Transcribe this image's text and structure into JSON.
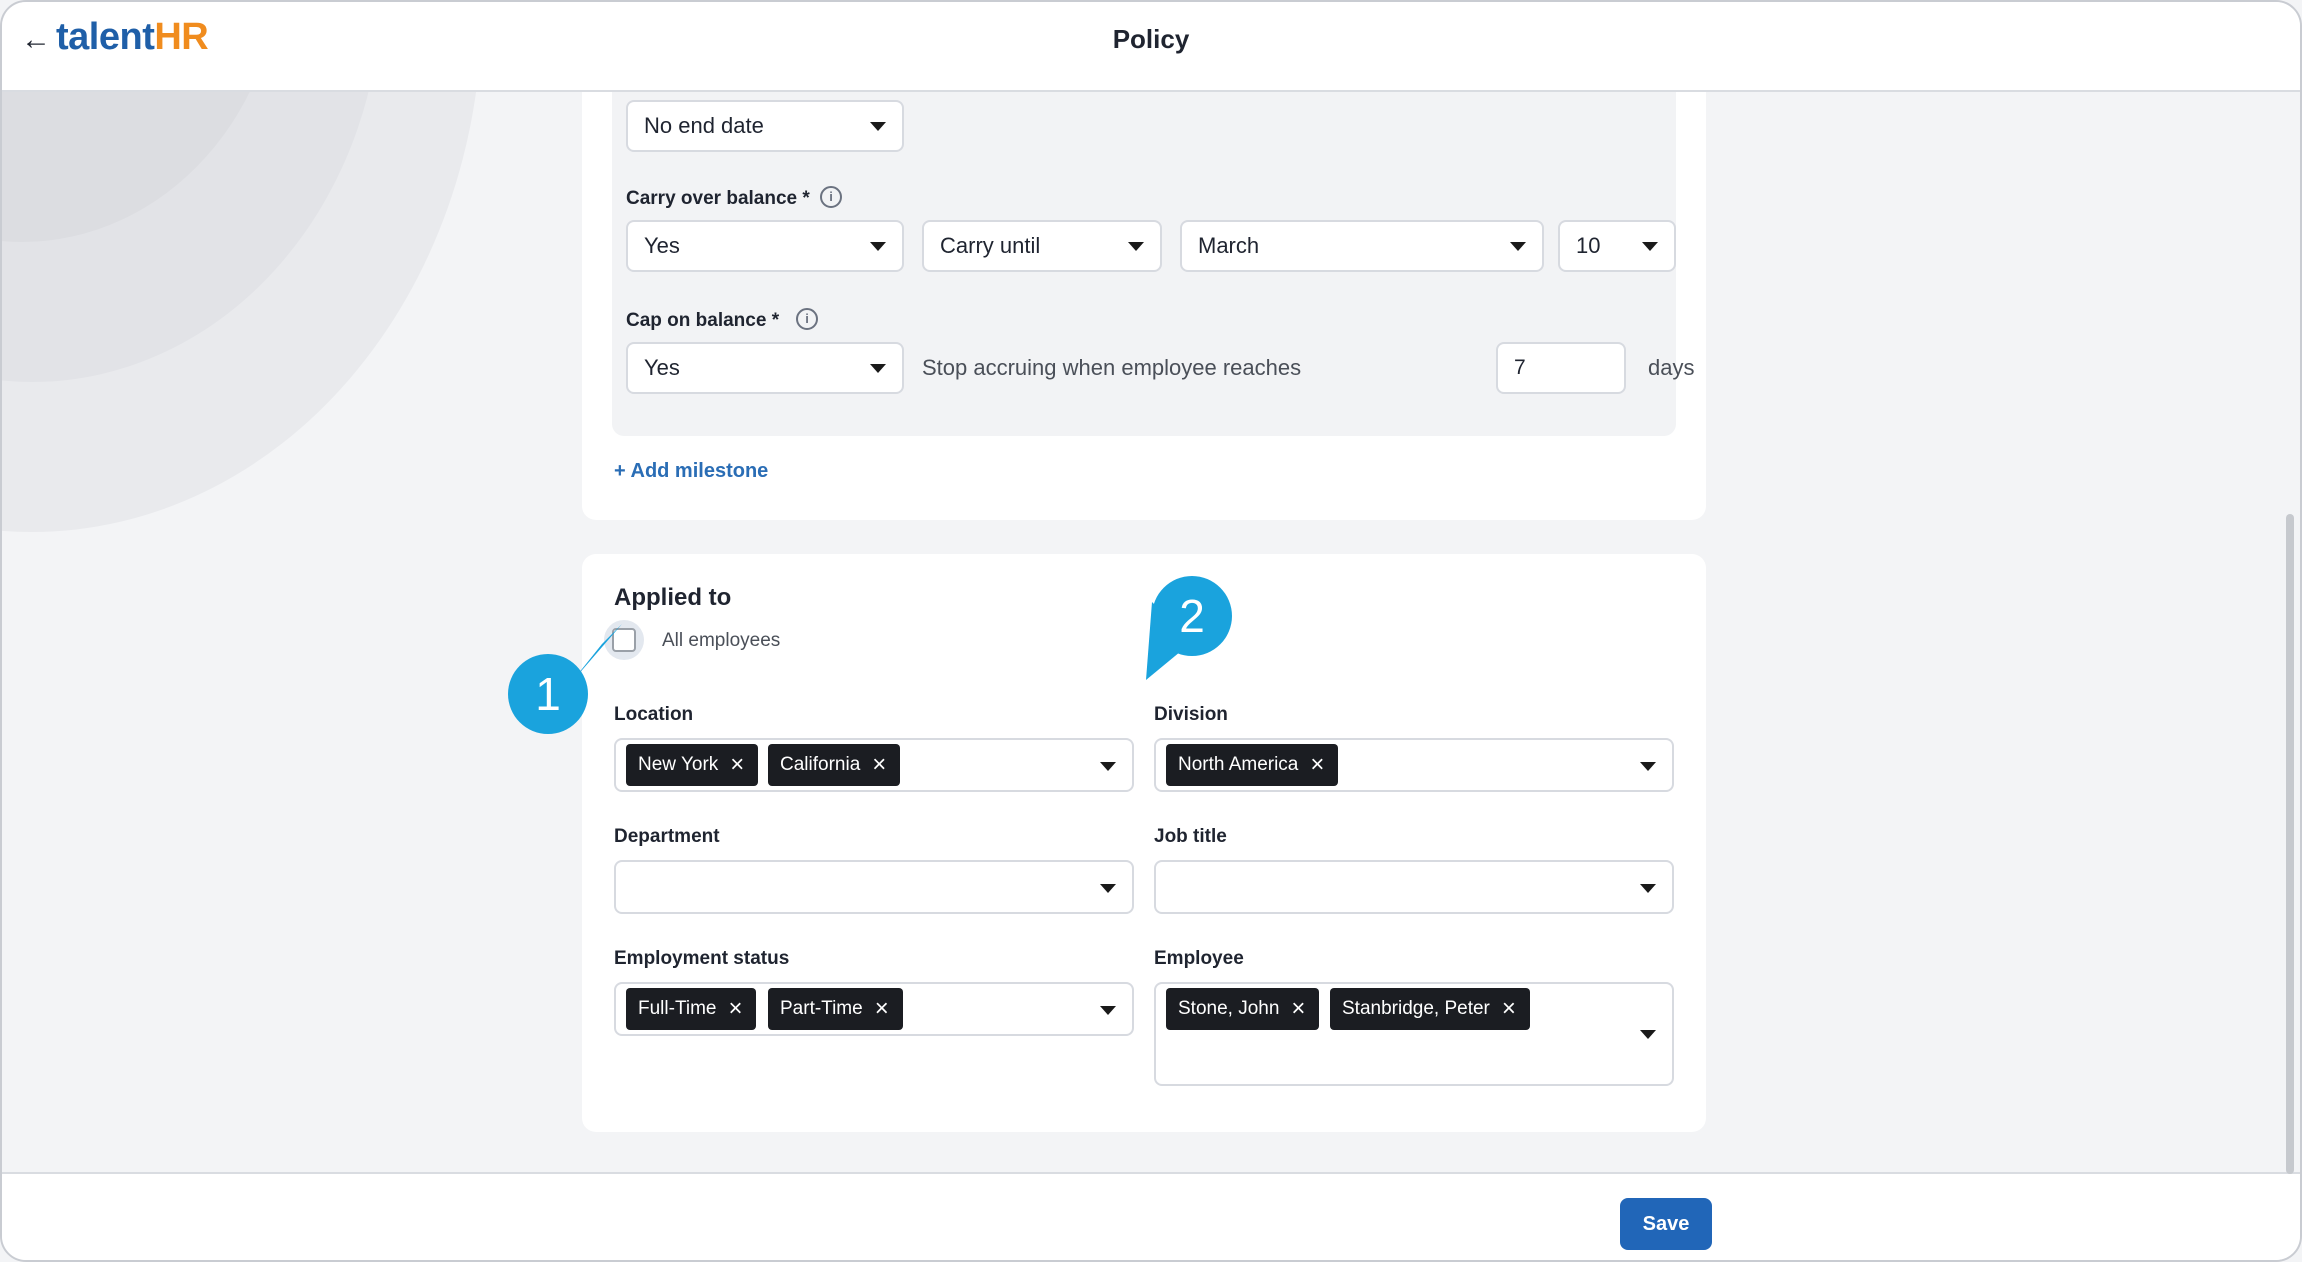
{
  "header": {
    "back_icon": "arrow-left-icon",
    "logo_part1": "talent",
    "logo_part2": "HR",
    "title": "Policy"
  },
  "milestone": {
    "end_date_value": "No end date",
    "carry_over": {
      "label": "Carry over balance *",
      "value": "Yes",
      "mode": "Carry until",
      "month": "March",
      "day": "10"
    },
    "cap": {
      "label": "Cap on balance *",
      "value": "Yes",
      "stop_text": "Stop accruing when employee reaches",
      "days_value": "7",
      "days_unit": "days"
    },
    "add_link": "+ Add milestone"
  },
  "applied_to": {
    "title": "Applied to",
    "all_employees_label": "All employees",
    "location": {
      "label": "Location",
      "chips": [
        "New York",
        "California"
      ]
    },
    "division": {
      "label": "Division",
      "chips": [
        "North America"
      ]
    },
    "department": {
      "label": "Department"
    },
    "job_title": {
      "label": "Job title"
    },
    "employment_status": {
      "label": "Employment status",
      "chips": [
        "Full-Time",
        "Part-Time"
      ]
    },
    "employee": {
      "label": "Employee",
      "chips": [
        "Stone, John",
        "Stanbridge, Peter"
      ]
    }
  },
  "callouts": [
    "1",
    "2"
  ],
  "footer": {
    "save_label": "Save"
  },
  "colors": {
    "primary": "#2166b8",
    "callout": "#1aa3dd",
    "chip": "#1b1d22",
    "logo_blue": "#1f5fa8",
    "logo_orange": "#f08c1e"
  }
}
